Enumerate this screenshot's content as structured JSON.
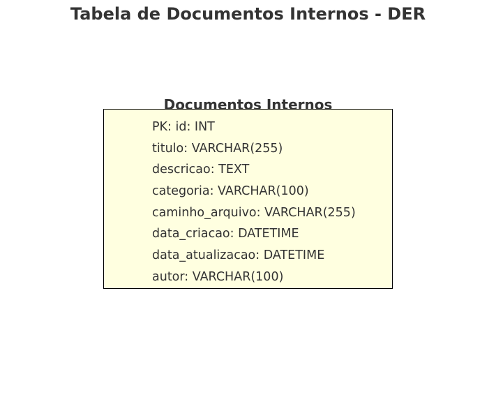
{
  "title": "Tabela de Documentos Internos - DER",
  "entity": {
    "name": "Documentos Internos",
    "box_fill": "#ffffe0",
    "border_color": "#000000",
    "attributes": [
      "PK: id: INT",
      "titulo: VARCHAR(255)",
      "descricao: TEXT",
      "categoria: VARCHAR(100)",
      "caminho_arquivo: VARCHAR(255)",
      "data_criacao: DATETIME",
      "data_atualizacao: DATETIME",
      "autor: VARCHAR(100)"
    ]
  }
}
